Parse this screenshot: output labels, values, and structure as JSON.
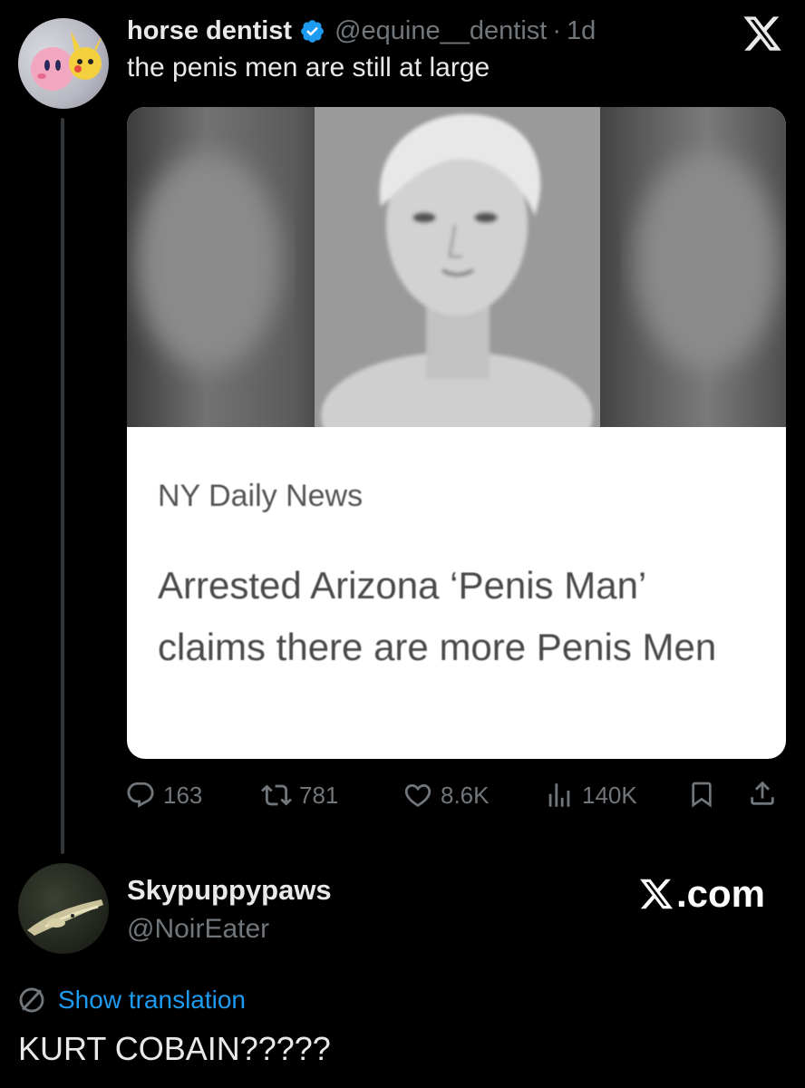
{
  "tweet": {
    "author_name": "horse dentist",
    "author_handle": "@equine__dentist",
    "separator": "·",
    "age": "1d",
    "verified": true,
    "text": "the penis men are still at large",
    "card": {
      "source": "NY Daily News",
      "headline": "Arrested Arizona ‘Penis Man’ claims there are more Penis Men"
    },
    "actions": {
      "replies": "163",
      "reposts": "781",
      "likes": "8.6K",
      "views": "140K"
    }
  },
  "reply": {
    "author_name": "Skypuppypaws",
    "author_handle": "@NoirEater",
    "translation_link": "Show translation",
    "text": "KURT COBAIN?????"
  },
  "watermark": {
    "text": ".com"
  },
  "colors": {
    "background": "#000000",
    "primary_text": "#e7e9ea",
    "secondary_text": "#71767b",
    "link_blue": "#1d9bf0",
    "verified_blue": "#1d9bf0",
    "card_background": "#ffffff"
  },
  "icons": [
    "x-logo-icon",
    "verified-badge-icon",
    "reply-icon",
    "repost-icon",
    "like-icon",
    "views-icon",
    "bookmark-icon",
    "share-icon",
    "globe-icon"
  ]
}
